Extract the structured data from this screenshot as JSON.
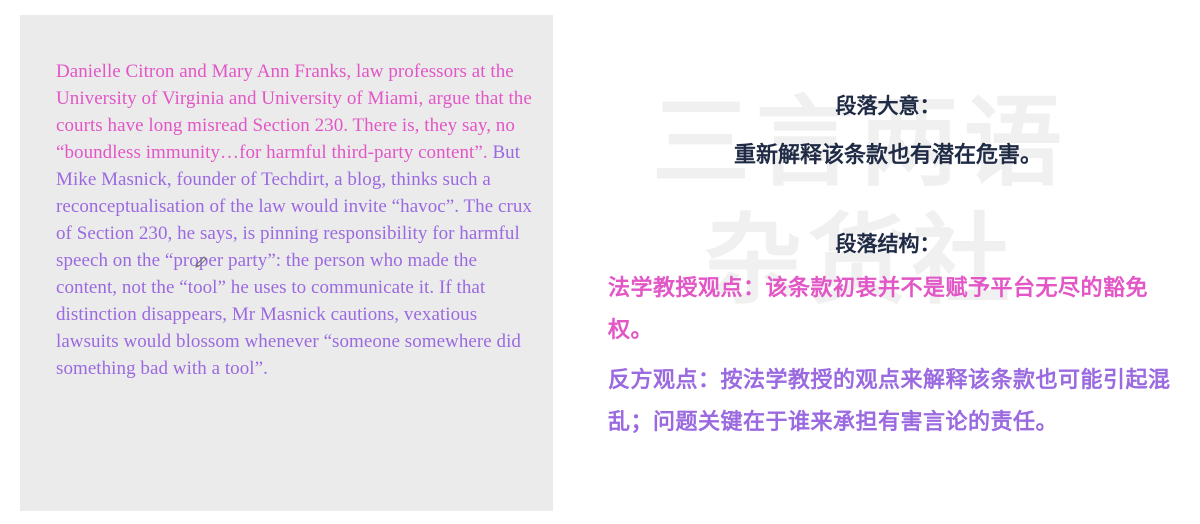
{
  "passage": {
    "pink_text": "Danielle Citron and Mary Ann Franks, law professors at the University of Virginia and University of Miami, argue that the courts have long misread Section 230. There is, they say, no “boundless immunity…for harmful third-party content”.",
    "purple_text": " But Mike Masnick, founder of Techdirt, a blog, thinks such a reconceptualisation of the law would invite “havoc”. The crux of Section 230, he says, is pinning responsibility for harmful speech on the “proper party”: the person who made the content, not the “tool” he uses to communicate it. If that distinction disappears, Mr Masnick cautions, vexatious lawsuits would blossom whenever “someone somewhere did something bad with a tool”."
  },
  "watermark": {
    "line1": "三言两语",
    "line2": "杂货社"
  },
  "right": {
    "main_idea_heading": "段落大意：",
    "main_idea_text": "重新解释该条款也有潜在危害。",
    "structure_heading": "段落结构：",
    "structure_pink": "法学教授观点：该条款初衷并不是赋予平台无尽的豁免权。",
    "structure_purple": "反方观点：按法学教授的观点来解释该条款也可能引起混乱；问题关键在于谁来承担有害言论的责任。"
  },
  "colors": {
    "pink": "#e256c6",
    "purple": "#9b6ae0",
    "heading": "#1f2a44",
    "panel": "#ebebeb"
  }
}
